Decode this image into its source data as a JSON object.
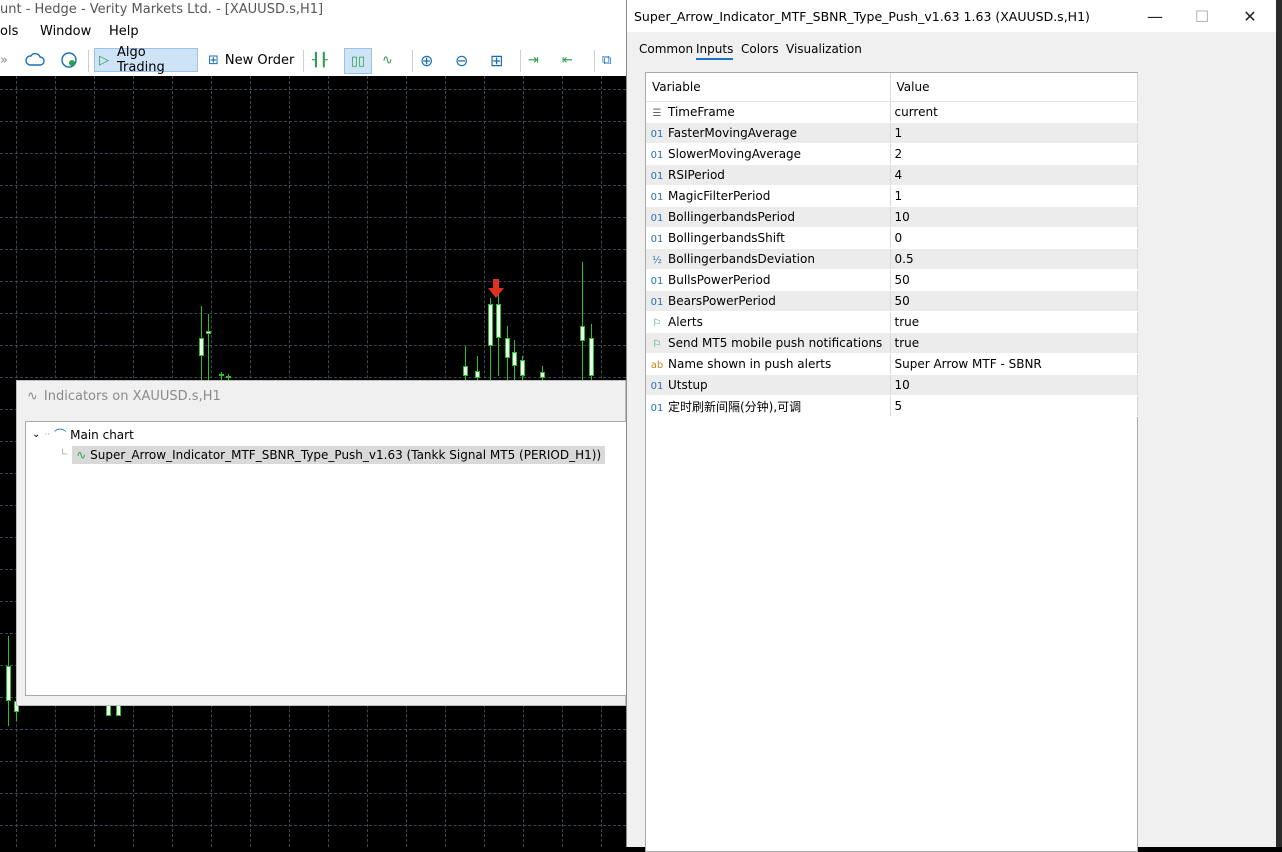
{
  "app": {
    "title": "unt - Hedge - Verity Markets Ltd. - [XAUUSD.s,H1]",
    "menu": [
      "ols",
      "Window",
      "Help"
    ],
    "toolbar": {
      "algo_trading": "Algo Trading",
      "new_order": "New Order"
    },
    "colors": {
      "chart_bg": "#000000",
      "bull": "#22c322",
      "arrow": "#e03020"
    }
  },
  "indicators_window": {
    "title": "Indicators on XAUUSD.s,H1",
    "tree": {
      "root": "Main chart",
      "child": "Super_Arrow_Indicator_MTF_SBNR_Type_Push_v1.63 (Tankk Signal MT5 (PERIOD_H1))"
    }
  },
  "properties_window": {
    "title": "Super_Arrow_Indicator_MTF_SBNR_Type_Push_v1.63 1.63 (XAUUSD.s,H1)",
    "controls": {
      "minimize": "—",
      "maximize": "☐",
      "close": "✕"
    },
    "tabs": [
      "Common",
      "Inputs",
      "Colors",
      "Visualization"
    ],
    "active_tab": "Inputs",
    "table": {
      "headers": [
        "Variable",
        "Value"
      ],
      "rows": [
        {
          "icon": "enum-icon",
          "icon_text": "☰",
          "variable": "TimeFrame",
          "value": "current"
        },
        {
          "icon": "int-icon",
          "icon_text": "01",
          "variable": "FasterMovingAverage",
          "value": "1"
        },
        {
          "icon": "int-icon",
          "icon_text": "01",
          "variable": "SlowerMovingAverage",
          "value": "2"
        },
        {
          "icon": "int-icon",
          "icon_text": "01",
          "variable": "RSIPeriod",
          "value": "4"
        },
        {
          "icon": "int-icon",
          "icon_text": "01",
          "variable": "MagicFilterPeriod",
          "value": "1"
        },
        {
          "icon": "int-icon",
          "icon_text": "01",
          "variable": "BollingerbandsPeriod",
          "value": "10"
        },
        {
          "icon": "int-icon",
          "icon_text": "01",
          "variable": "BollingerbandsShift",
          "value": "0"
        },
        {
          "icon": "double-icon",
          "icon_text": "½",
          "variable": "BollingerbandsDeviation",
          "value": "0.5"
        },
        {
          "icon": "int-icon",
          "icon_text": "01",
          "variable": "BullsPowerPeriod",
          "value": "50"
        },
        {
          "icon": "int-icon",
          "icon_text": "01",
          "variable": "BearsPowerPeriod",
          "value": "50"
        },
        {
          "icon": "bool-icon",
          "icon_text": "⚐",
          "variable": "Alerts",
          "value": "true"
        },
        {
          "icon": "bool-icon",
          "icon_text": "⚐",
          "variable": "Send MT5 mobile push notifications",
          "value": "true"
        },
        {
          "icon": "string-icon",
          "icon_text": "ab",
          "variable": "Name shown in push alerts",
          "value": "Super Arrow MTF - SBNR"
        },
        {
          "icon": "int-icon",
          "icon_text": "01",
          "variable": "Utstup",
          "value": "10"
        },
        {
          "icon": "int-icon",
          "icon_text": "01",
          "variable": "定时刷新间隔(分钟),可调",
          "value": "5"
        }
      ]
    }
  }
}
